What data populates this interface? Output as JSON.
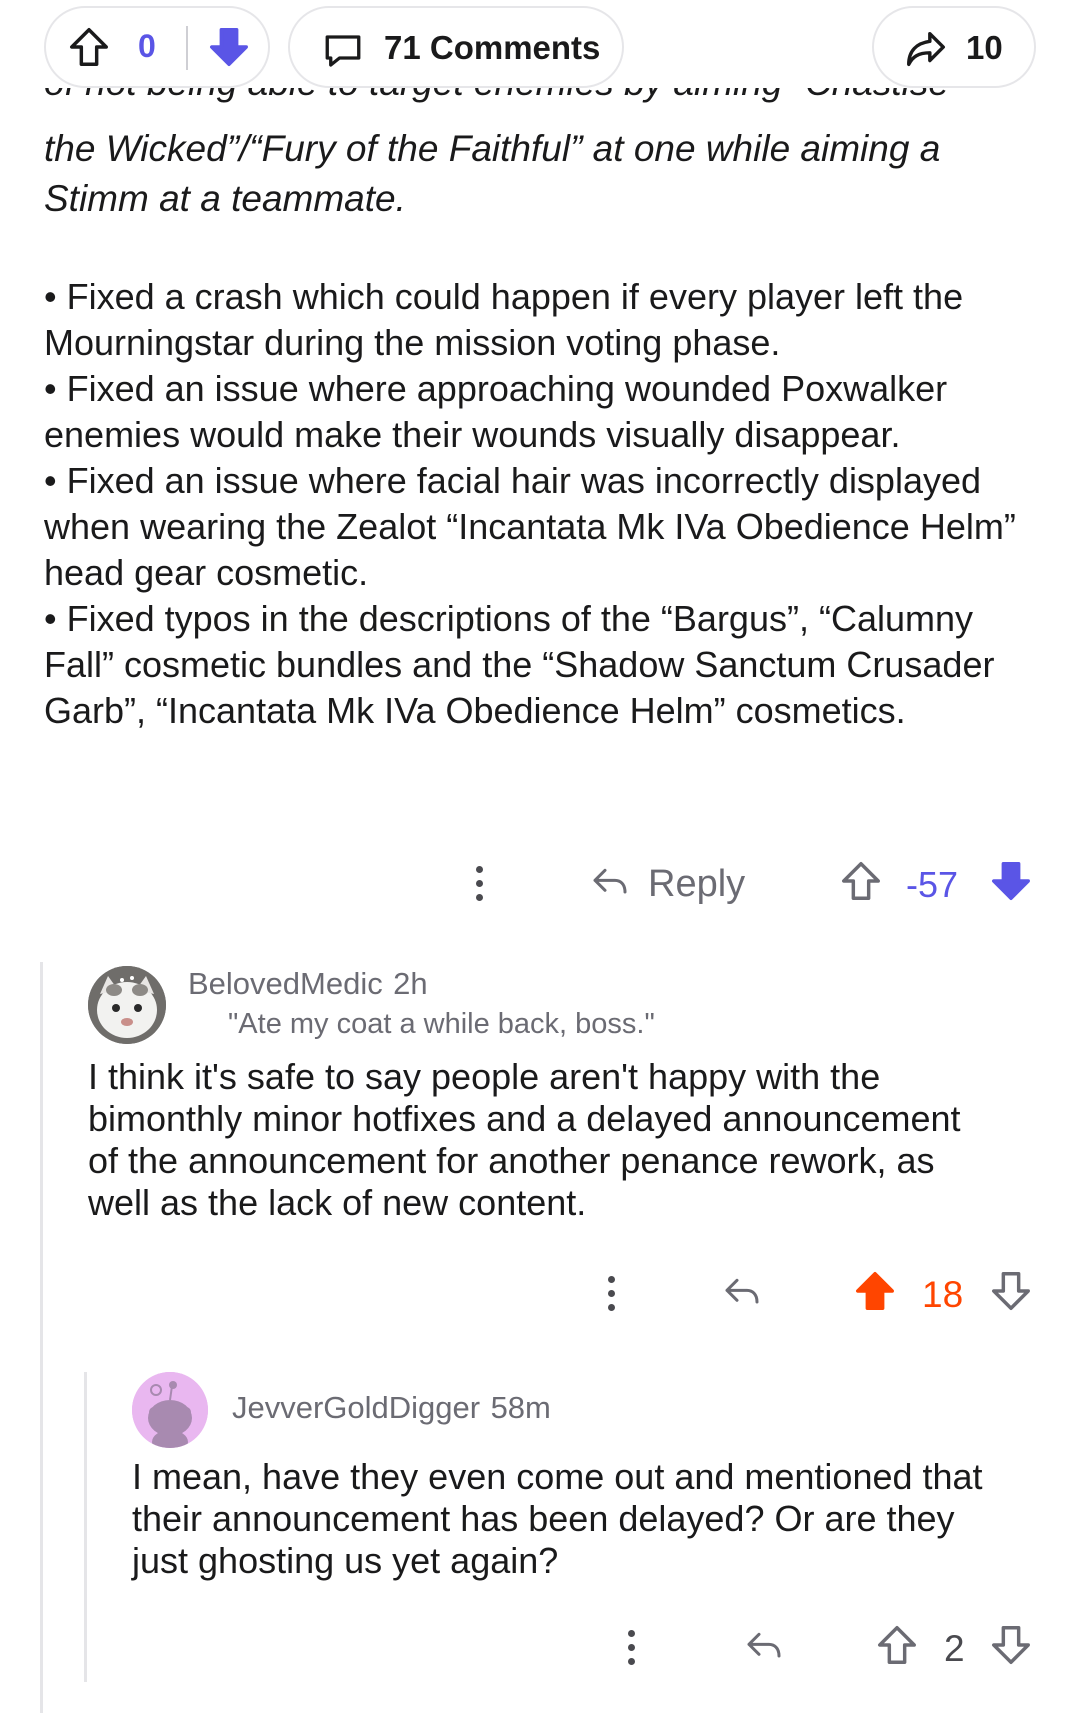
{
  "top_bar": {
    "score": "0",
    "comments_label": "71 Comments",
    "share_count": "10"
  },
  "post": {
    "clipped_line": "of not being able to target enemies by aiming “Chastise",
    "italic_lines": [
      "the Wicked”/“Fury of the Faithful” at one while aiming a",
      "Stimm at a teammate."
    ],
    "bullets": [
      "• Fixed a crash which could happen if every player left the Mourningstar during the mission voting phase.",
      "• Fixed an issue where approaching wounded Poxwalker enemies would make their wounds visually disappear.",
      "• Fixed an issue where facial hair was incorrectly displayed when wearing the Zealot “Incantata Mk IVa Obedience Helm” head gear cosmetic.",
      "• Fixed typos in the descriptions of the “Bargus”, “Calumny Fall” cosmetic bundles and the “Shadow Sanctum Crusader Garb”, “Incantata Mk IVa Obedience Helm” cosmetics."
    ],
    "reply_label": "Reply",
    "score": "-57"
  },
  "comments": [
    {
      "username": "BelovedMedic",
      "time": "2h",
      "flair": "\"Ate my coat a while back, boss.\"",
      "text": "I think it's safe to say people aren't happy with the bimonthly minor hotfixes and a delayed announcement of the announcement for another penance rework, as well as the lack of new content.",
      "score": "18"
    },
    {
      "username": "JevverGoldDigger",
      "time": "58m",
      "text": "I mean, have they even come out and mentioned that their announcement has been delayed? Or are they just ghosting us yet again?",
      "score": "2"
    }
  ],
  "colors": {
    "downvote_active": "#5a55e6",
    "upvote_active": "#ff4500",
    "avatar_bg_2": "#e9b7f0"
  }
}
